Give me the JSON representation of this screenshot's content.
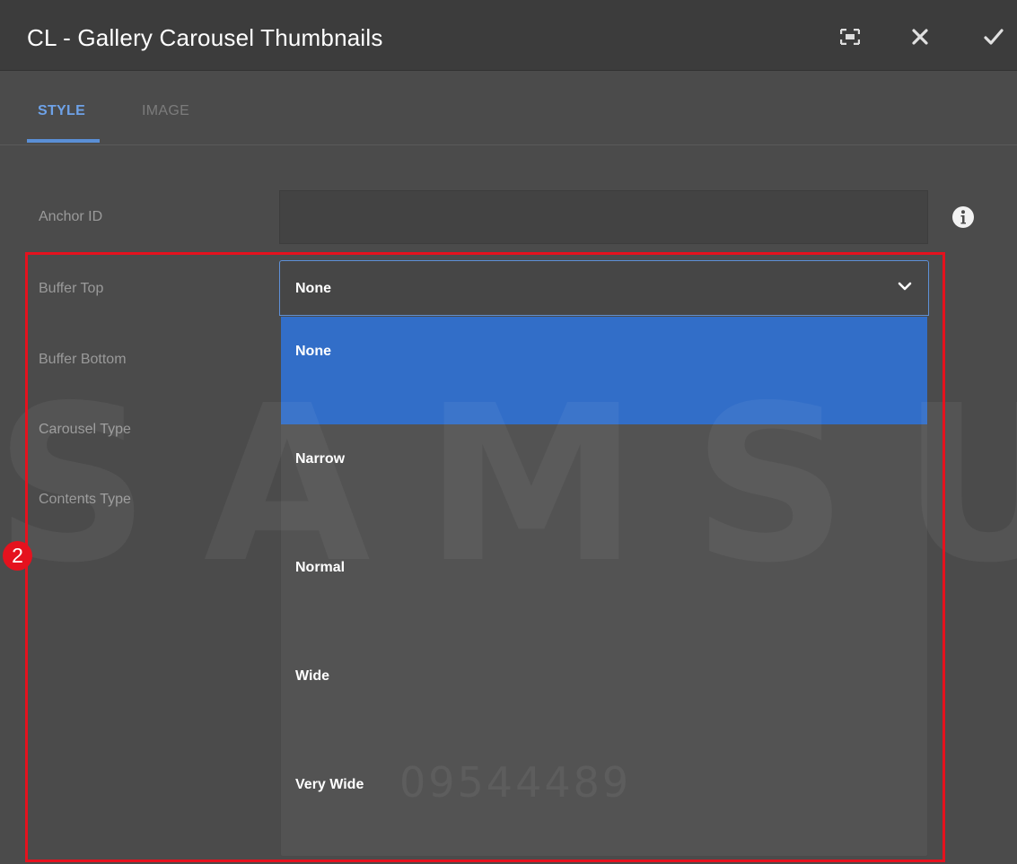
{
  "dialog": {
    "title": "CL - Gallery Carousel Thumbnails",
    "buttons": [
      "fullscreen-icon",
      "close-icon",
      "checkmark-icon"
    ]
  },
  "tabs": [
    {
      "label": "STYLE",
      "active": true
    },
    {
      "label": "IMAGE",
      "active": false
    }
  ],
  "fields": {
    "anchor_id": {
      "label": "Anchor ID",
      "value": "",
      "icon": "info-icon"
    },
    "buffer_top": {
      "label": "Buffer Top",
      "value": "None"
    },
    "buffer_bottom": {
      "label": "Buffer Bottom"
    },
    "carousel_type": {
      "label": "Carousel Type"
    },
    "contents_type": {
      "label": "Contents Type"
    }
  },
  "dropdown": {
    "options": [
      "None",
      "Narrow",
      "Normal",
      "Wide",
      "Very Wide"
    ],
    "selected": "None"
  },
  "annotation": {
    "badge": "2",
    "color": "#e5121e"
  },
  "watermark": {
    "text": "SAMSUNG",
    "number": "09544489"
  },
  "colors": {
    "accent": "#326ec8",
    "tab_active": "#6ea2e8"
  }
}
